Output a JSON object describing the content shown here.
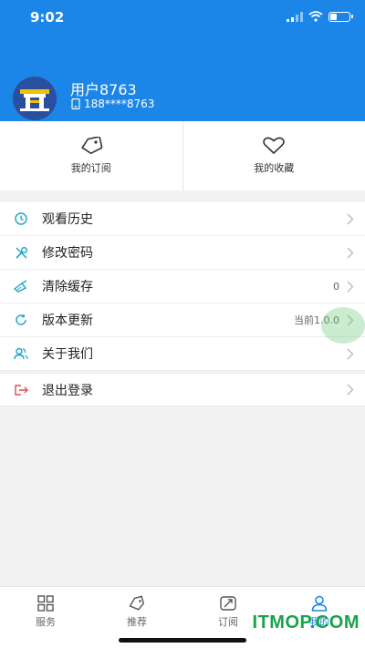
{
  "status_bar": {
    "time": "9:02",
    "battery_level": 0.35
  },
  "profile": {
    "username": "用户8763",
    "phone": "188****8763"
  },
  "quick_actions": [
    {
      "label": "我的订阅",
      "icon": "tag-icon"
    },
    {
      "label": "我的收藏",
      "icon": "heart-icon"
    }
  ],
  "menu": [
    {
      "label": "观看历史",
      "value": "",
      "icon": "clock-icon"
    },
    {
      "label": "修改密码",
      "value": "",
      "icon": "tools-icon"
    },
    {
      "label": "清除缓存",
      "value": "0",
      "icon": "broom-icon"
    },
    {
      "label": "版本更新",
      "value": "当前1.0.0",
      "icon": "refresh-icon"
    },
    {
      "label": "关于我们",
      "value": "",
      "icon": "users-icon"
    }
  ],
  "logout": {
    "label": "退出登录",
    "icon": "logout-icon"
  },
  "tabs": [
    {
      "label": "服务",
      "icon": "grid-icon",
      "active": false
    },
    {
      "label": "推荐",
      "icon": "tag-icon",
      "active": false
    },
    {
      "label": "订阅",
      "icon": "rocket-icon",
      "active": false
    },
    {
      "label": "我的",
      "icon": "person-icon",
      "active": true
    }
  ],
  "colors": {
    "brand": "#1b86e8",
    "icon_teal": "#1aa5c8",
    "logout_red": "#e84a4a"
  },
  "watermark": "ITMOP.COM"
}
